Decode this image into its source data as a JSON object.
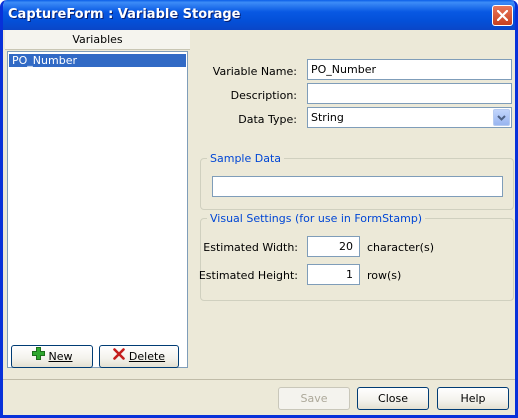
{
  "window": {
    "title": "CaptureForm : Variable Storage",
    "accent": "#0a5ee8"
  },
  "list": {
    "header": "Variables",
    "items": [
      {
        "label": "PO_Number",
        "selected": true
      }
    ],
    "selection_color": "#316ac5"
  },
  "buttons": {
    "new_label": "New",
    "delete_label": "Delete",
    "save_label": "Save",
    "close_label": "Close",
    "help_label": "Help"
  },
  "form": {
    "variable_name_label": "Variable Name:",
    "variable_name_value": "PO_Number",
    "description_label": "Description:",
    "description_value": "",
    "data_type_label": "Data Type:",
    "data_type_value": "String"
  },
  "sample_data": {
    "title": "Sample Data",
    "value": ""
  },
  "visual_settings": {
    "title": "Visual Settings (for use in FormStamp)",
    "width_label": "Estimated Width:",
    "width_value": "20",
    "width_unit": "character(s)",
    "height_label": "Estimated Height:",
    "height_value": "1",
    "height_unit": "row(s)"
  },
  "icons": {
    "new": "plus-icon",
    "delete": "x-icon",
    "close_window": "close-icon",
    "dropdown": "chevron-down-icon"
  },
  "colors": {
    "group_title": "#0046d5",
    "plus": "#2fa82f",
    "delete": "#c41e1e"
  }
}
